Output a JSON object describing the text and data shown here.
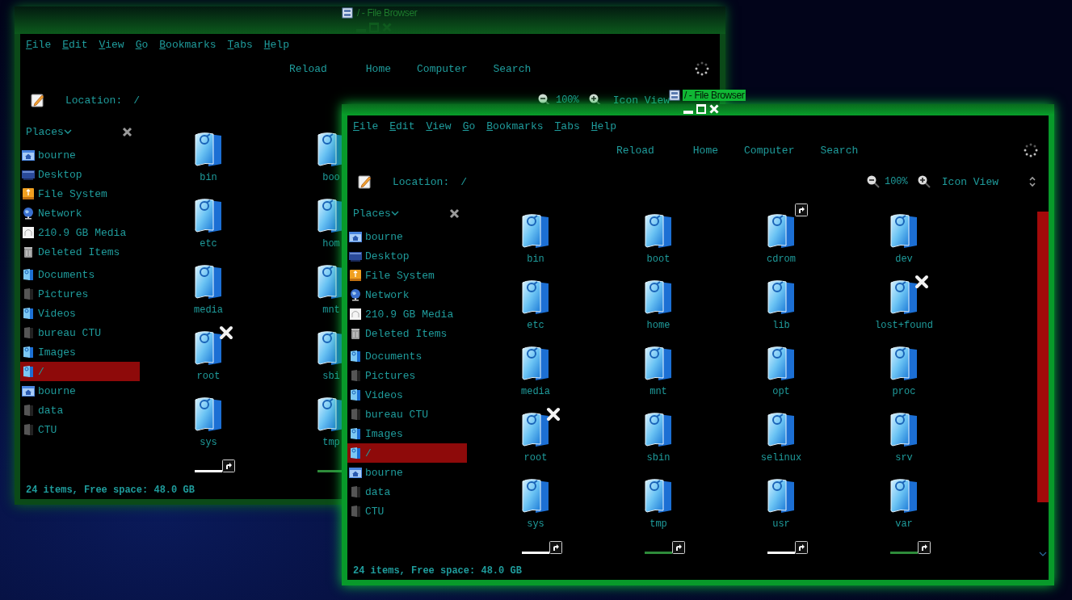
{
  "windows": [
    {
      "title": "/ - File Browser",
      "active": false,
      "menus": [
        "File",
        "Edit",
        "View",
        "Go",
        "Bookmarks",
        "Tabs",
        "Help"
      ],
      "toolbar": [
        "Reload",
        "Home",
        "Computer",
        "Search"
      ],
      "location": {
        "label": "Location:",
        "path": "/"
      },
      "zoom": {
        "value": "100%",
        "view": "Icon View"
      },
      "sidebar": {
        "title": "Places",
        "sections": [
          [
            {
              "label": "bourne",
              "kind": "home",
              "selected": false
            },
            {
              "label": "Desktop",
              "kind": "desktop",
              "selected": false
            },
            {
              "label": "File System",
              "kind": "filesystem",
              "selected": false
            },
            {
              "label": "Network",
              "kind": "network",
              "selected": false
            },
            {
              "label": "210.9 GB Media",
              "kind": "drive",
              "selected": false
            },
            {
              "label": "Deleted Items",
              "kind": "trash",
              "selected": false
            }
          ],
          [
            {
              "label": "Documents",
              "kind": "folder",
              "selected": false
            },
            {
              "label": "Pictures",
              "kind": "dark",
              "selected": false
            },
            {
              "label": "Videos",
              "kind": "folder",
              "selected": false
            },
            {
              "label": "bureau CTU",
              "kind": "dark",
              "selected": false
            },
            {
              "label": "Images",
              "kind": "folder",
              "selected": false
            },
            {
              "label": "/",
              "kind": "folder",
              "selected": true
            },
            {
              "label": "bourne",
              "kind": "home",
              "selected": false
            },
            {
              "label": "data",
              "kind": "dark",
              "selected": false
            },
            {
              "label": "CTU",
              "kind": "dark",
              "selected": false
            }
          ]
        ]
      },
      "files": [
        {
          "name": "bin",
          "shortcut": false,
          "unreadable": false
        },
        {
          "name": "boo",
          "shortcut": false,
          "unreadable": false
        },
        {
          "name": "etc",
          "shortcut": false,
          "unreadable": false
        },
        {
          "name": "hom",
          "shortcut": false,
          "unreadable": false
        },
        {
          "name": "media",
          "shortcut": false,
          "unreadable": false
        },
        {
          "name": "mnt",
          "shortcut": false,
          "unreadable": false
        },
        {
          "name": "root",
          "shortcut": false,
          "unreadable": true
        },
        {
          "name": "sbi",
          "shortcut": false,
          "unreadable": false
        },
        {
          "name": "sys",
          "shortcut": false,
          "unreadable": false
        },
        {
          "name": "tmp",
          "shortcut": false,
          "unreadable": false
        }
      ],
      "partial_row": [
        {
          "color": "#ffffff",
          "shortcut": true
        },
        {
          "color": "#2e8b3a",
          "shortcut": false
        }
      ],
      "status": "24 items, Free space: 48.0 GB"
    },
    {
      "title": "/ - File Browser",
      "active": true,
      "menus": [
        "File",
        "Edit",
        "View",
        "Go",
        "Bookmarks",
        "Tabs",
        "Help"
      ],
      "toolbar": [
        "Reload",
        "Home",
        "Computer",
        "Search"
      ],
      "location": {
        "label": "Location:",
        "path": "/"
      },
      "zoom": {
        "value": "100%",
        "view": "Icon View",
        "view_arrows": true
      },
      "sidebar": {
        "title": "Places",
        "sections": [
          [
            {
              "label": "bourne",
              "kind": "home",
              "selected": false
            },
            {
              "label": "Desktop",
              "kind": "desktop",
              "selected": false
            },
            {
              "label": "File System",
              "kind": "filesystem",
              "selected": false
            },
            {
              "label": "Network",
              "kind": "network",
              "selected": false
            },
            {
              "label": "210.9 GB Media",
              "kind": "drive",
              "selected": false
            },
            {
              "label": "Deleted Items",
              "kind": "trash",
              "selected": false
            }
          ],
          [
            {
              "label": "Documents",
              "kind": "folder",
              "selected": false
            },
            {
              "label": "Pictures",
              "kind": "dark",
              "selected": false
            },
            {
              "label": "Videos",
              "kind": "folder",
              "selected": false
            },
            {
              "label": "bureau CTU",
              "kind": "dark",
              "selected": false
            },
            {
              "label": "Images",
              "kind": "folder",
              "selected": false
            },
            {
              "label": "/",
              "kind": "folder",
              "selected": true
            },
            {
              "label": "bourne",
              "kind": "home",
              "selected": false
            },
            {
              "label": "data",
              "kind": "dark",
              "selected": false
            },
            {
              "label": "CTU",
              "kind": "dark",
              "selected": false
            }
          ]
        ]
      },
      "files": [
        {
          "name": "bin",
          "shortcut": false,
          "unreadable": false
        },
        {
          "name": "boot",
          "shortcut": false,
          "unreadable": false
        },
        {
          "name": "cdrom",
          "shortcut": true,
          "unreadable": false
        },
        {
          "name": "dev",
          "shortcut": false,
          "unreadable": false
        },
        {
          "name": "etc",
          "shortcut": false,
          "unreadable": false
        },
        {
          "name": "home",
          "shortcut": false,
          "unreadable": false
        },
        {
          "name": "lib",
          "shortcut": false,
          "unreadable": false
        },
        {
          "name": "lost+found",
          "shortcut": false,
          "unreadable": true
        },
        {
          "name": "media",
          "shortcut": false,
          "unreadable": false
        },
        {
          "name": "mnt",
          "shortcut": false,
          "unreadable": false
        },
        {
          "name": "opt",
          "shortcut": false,
          "unreadable": false
        },
        {
          "name": "proc",
          "shortcut": false,
          "unreadable": false
        },
        {
          "name": "root",
          "shortcut": false,
          "unreadable": true
        },
        {
          "name": "sbin",
          "shortcut": false,
          "unreadable": false
        },
        {
          "name": "selinux",
          "shortcut": false,
          "unreadable": false
        },
        {
          "name": "srv",
          "shortcut": false,
          "unreadable": false
        },
        {
          "name": "sys",
          "shortcut": false,
          "unreadable": false
        },
        {
          "name": "tmp",
          "shortcut": false,
          "unreadable": false
        },
        {
          "name": "usr",
          "shortcut": false,
          "unreadable": false
        },
        {
          "name": "var",
          "shortcut": false,
          "unreadable": false
        }
      ],
      "partial_row": [
        {
          "color": "#ffffff",
          "shortcut": true
        },
        {
          "color": "#2e8b3a",
          "shortcut": true
        },
        {
          "color": "#ffffff",
          "shortcut": true
        },
        {
          "color": "#2e8b3a",
          "shortcut": true
        }
      ],
      "scrollbar": true,
      "status": "24 items, Free space: 48.0 GB"
    }
  ]
}
